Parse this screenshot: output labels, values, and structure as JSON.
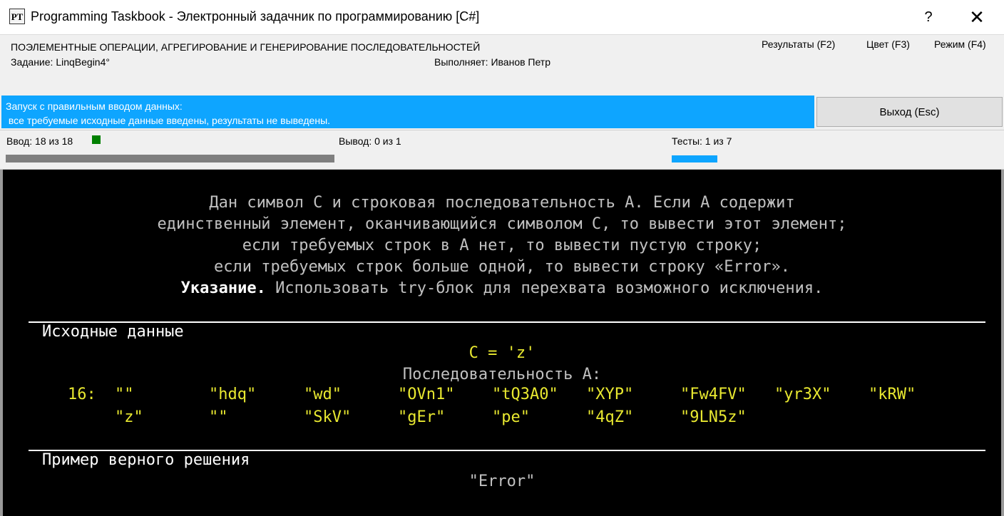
{
  "window": {
    "icon_text": "PT",
    "title": "Programming Taskbook - Электронный задачник по программированию [C#]",
    "help_label": "?",
    "close_label": "✕"
  },
  "header": {
    "group_title": "ПОЭЛЕМЕНТНЫЕ ОПЕРАЦИИ, АГРЕГИРОВАНИЕ И ГЕНЕРИРОВАНИЕ ПОСЛЕДОВАТЕЛЬНОСТЕЙ",
    "task_label": "Задание: LinqBegin4°",
    "performer_label": "Выполняет: Иванов Петр",
    "menu": {
      "results": "Результаты (F2)",
      "color": "Цвет (F3)",
      "mode": "Режим (F4)"
    }
  },
  "status": {
    "line1": "Запуск с правильным вводом данных:",
    "line2": " все требуемые исходные данные введены, результаты не выведены.",
    "exit_label": "Выход (Esc)"
  },
  "progress": {
    "input_label": "Ввод:  18 из 18",
    "output_label": "Вывод:  0 из 1",
    "tests_label": "Тесты:  1 из 7",
    "input_fraction": 1.0,
    "tests_fraction": 0.142857,
    "colors": {
      "input_bar": "#7f7f7f",
      "tests_bar": "#0ea5ff",
      "input_indicator": "#008000",
      "status_bg": "#0ea5ff"
    }
  },
  "console": {
    "task_lines": [
      "Дан символ C и строковая последовательность A. Если A содержит",
      "единственный элемент, оканчивающийся символом C, то вывести этот элемент;",
      "если требуемых строк в A нет, то вывести пустую строку;",
      "если требуемых строк больше одной, то вывести строку «Error»."
    ],
    "hint_bold": "Указание.",
    "hint_text": " Использовать try-блок для перехвата возможного исключения.",
    "input_heading": "Исходные данные",
    "c_value": "C = 'z'",
    "seq_label": "Последовательность A:",
    "seq_count": "16:",
    "seq_row1": [
      "\"\"",
      "\"hdq\"",
      "\"wd\"",
      "\"OVn1\"",
      "\"tQ3A0\"",
      "\"XYP\"",
      "\"Fw4FV\"",
      "\"yr3X\"",
      "\"kRW\""
    ],
    "seq_row2": [
      "\"z\"",
      "\"\"",
      "\"SkV\"",
      "\"gEr\"",
      "\"pe\"",
      "\"4qZ\"",
      "\"9LN5z\""
    ],
    "example_heading": "Пример верного решения",
    "example_answer": "\"Error\"",
    "colors": {
      "text": "#c0c0c0",
      "data": "#e8e830",
      "heading": "#ffffff",
      "background": "#000000"
    }
  }
}
